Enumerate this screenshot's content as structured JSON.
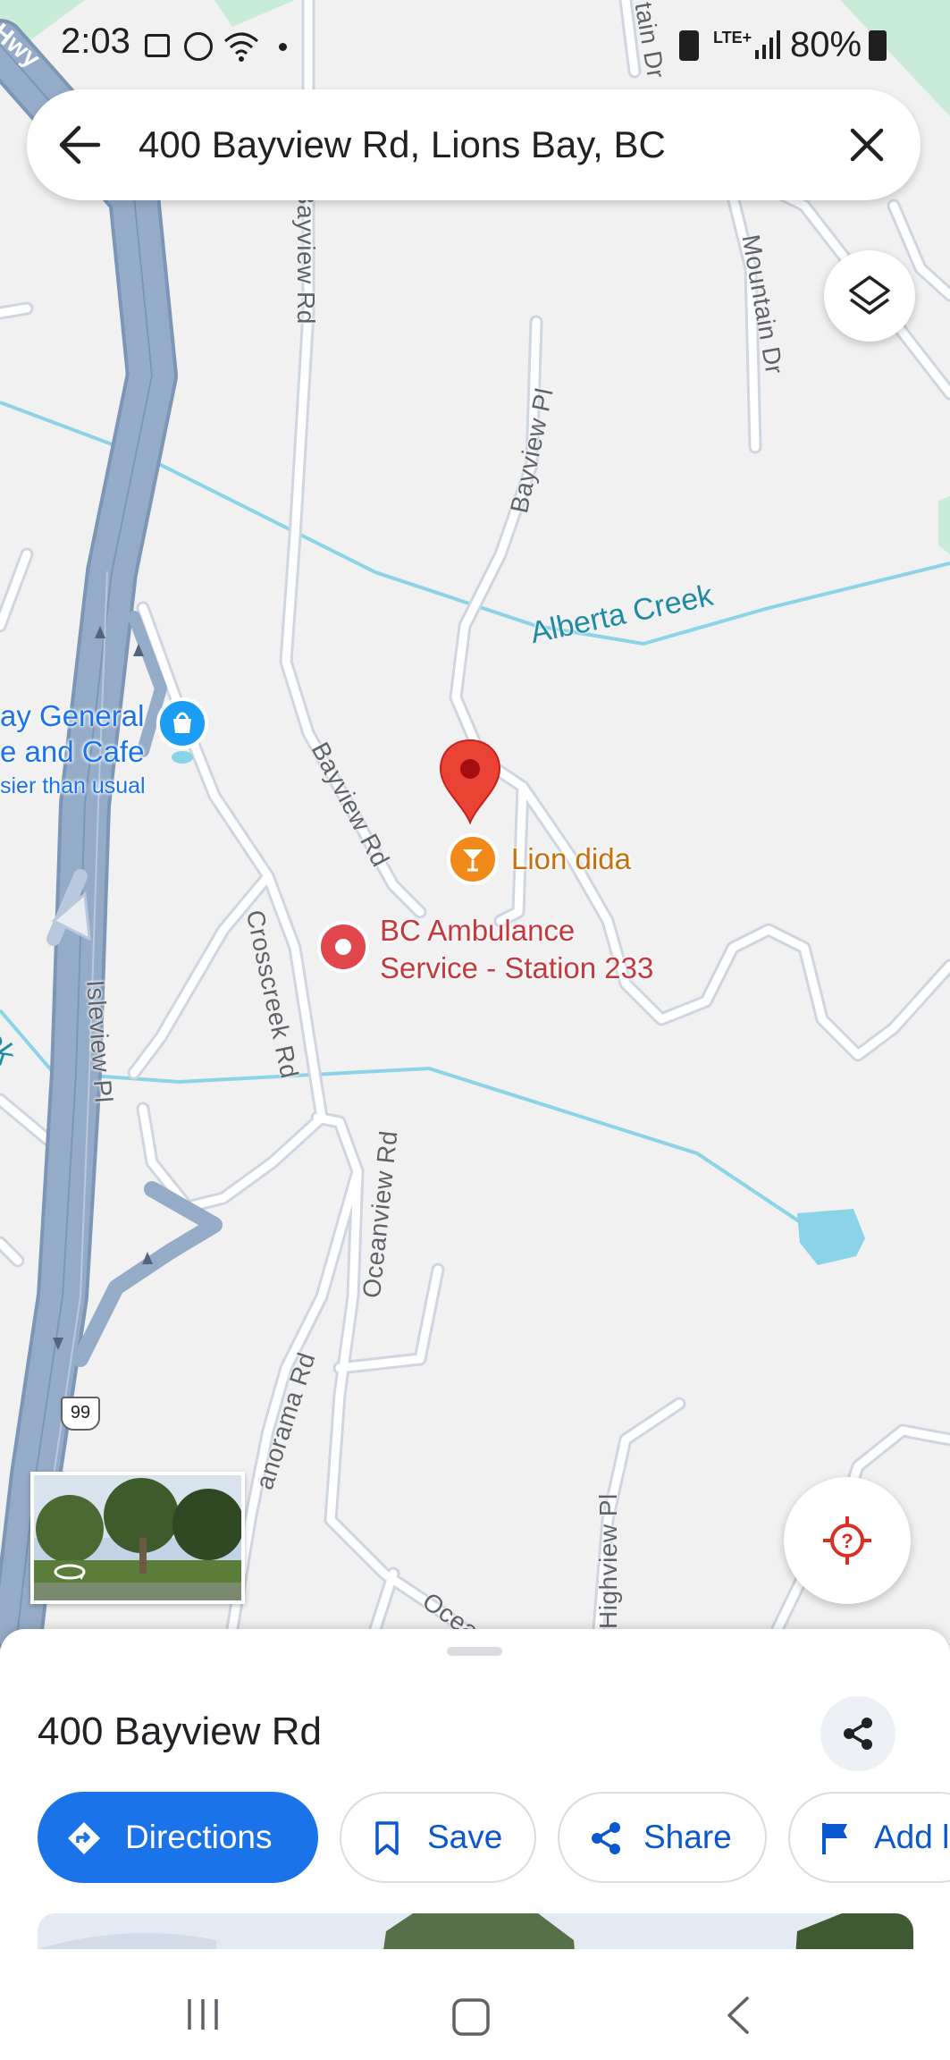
{
  "status_bar": {
    "time": "2:03",
    "battery": "80%",
    "network": "LTE+"
  },
  "search": {
    "query": "400 Bayview Rd, Lions Bay, BC"
  },
  "map": {
    "roads": [
      {
        "name": "Bayview Rd"
      },
      {
        "name": "Mountain Dr"
      },
      {
        "name": "Bayview Pl"
      },
      {
        "name": "Bayview Rd"
      },
      {
        "name": "Crosscreek Rd"
      },
      {
        "name": "Isleview Pl"
      },
      {
        "name": "Oceanview Rd"
      },
      {
        "name": "anorama Rd"
      },
      {
        "name": "Highview Pl"
      },
      {
        "name": "Ocean"
      },
      {
        "name": "tain Dr"
      },
      {
        "name": "Hwy"
      }
    ],
    "creeks": [
      {
        "name": "Alberta Creek"
      },
      {
        "name": "eek"
      }
    ],
    "highway_shield": "99",
    "pois": {
      "general_store": {
        "line1": "ay General",
        "line2": "e and Cafe",
        "line3": "sier than usual"
      },
      "lion_dida": "Lion dida",
      "ambulance": {
        "line1": "BC Ambulance",
        "line2": "Service - Station 233"
      }
    },
    "colors": {
      "map_bg": "#f1f1f1",
      "highway": "#8fa9c7",
      "road": "#ffffff",
      "water": "#8bd3e6",
      "park": "#c8ecd8",
      "pin": "#ea4335",
      "poi_orange": "#f18a1b",
      "poi_blue": "#1a9df2",
      "ambulance_red": "#e0474c"
    }
  },
  "sheet": {
    "title": "400 Bayview Rd",
    "actions": [
      {
        "label": "Directions",
        "icon": "directions-icon"
      },
      {
        "label": "Save",
        "icon": "bookmark-icon"
      },
      {
        "label": "Share",
        "icon": "share-icon"
      },
      {
        "label": "Add l",
        "icon": "flag-icon"
      }
    ]
  },
  "accent_color": "#0b57d0"
}
